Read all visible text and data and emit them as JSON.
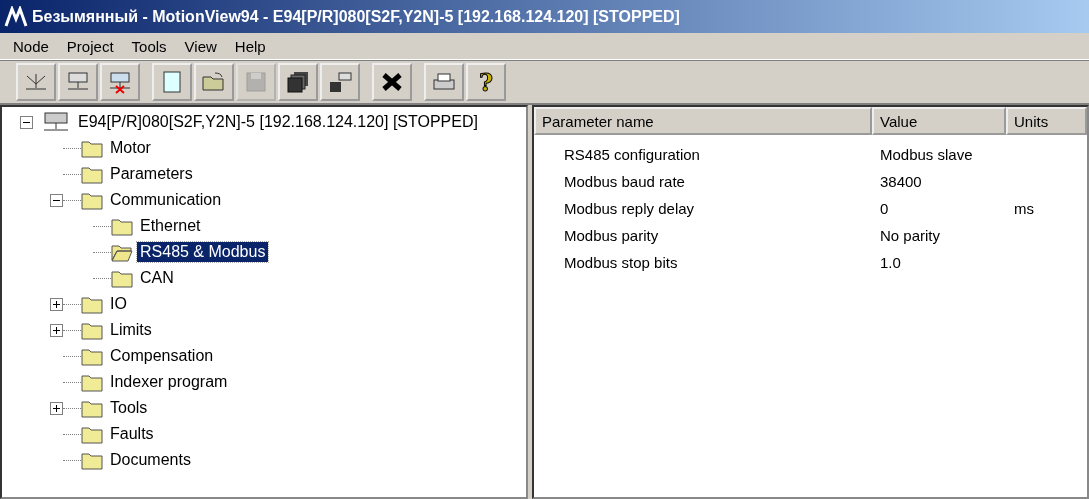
{
  "window": {
    "title": "Безымянный - MotionView94 - E94[P/R]080[S2F,Y2N]-5 [192.168.124.120] [STOPPED]"
  },
  "menu": [
    "Node",
    "Project",
    "Tools",
    "View",
    "Help"
  ],
  "toolbar": {
    "groups": [
      [
        {
          "disabled": false
        },
        {
          "disabled": false
        },
        {
          "disabled": false
        }
      ],
      [
        {
          "disabled": false
        },
        {
          "disabled": false
        },
        {
          "disabled": true
        },
        {
          "disabled": false
        },
        {
          "disabled": false
        }
      ],
      [
        {
          "disabled": false
        }
      ],
      [
        {
          "disabled": false
        },
        {
          "disabled": false,
          "label": "?"
        }
      ]
    ]
  },
  "tree": {
    "label": "E94[P/R]080[S2F,Y2N]-5 [192.168.124.120] [STOPPED]",
    "expanded": true,
    "children": [
      {
        "label": "Motor",
        "selected": false
      },
      {
        "label": "Parameters",
        "selected": false
      },
      {
        "label": "Communication",
        "expanded": true,
        "selected": false,
        "children": [
          {
            "label": "Ethernet",
            "selected": false
          },
          {
            "label": "RS485 & Modbus",
            "selected": true
          },
          {
            "label": "CAN",
            "selected": false
          }
        ]
      },
      {
        "label": "IO",
        "expanded": false,
        "selected": false
      },
      {
        "label": "Limits",
        "expanded": false,
        "selected": false
      },
      {
        "label": "Compensation",
        "selected": false
      },
      {
        "label": "Indexer program",
        "selected": false
      },
      {
        "label": "Tools",
        "expanded": false,
        "selected": false
      },
      {
        "label": "Faults",
        "selected": false
      },
      {
        "label": "Documents",
        "selected": false
      }
    ]
  },
  "table": {
    "columns": [
      "Parameter name",
      "Value",
      "Units"
    ],
    "rows": [
      [
        "RS485 configuration",
        "Modbus slave",
        ""
      ],
      [
        "Modbus baud rate",
        "38400",
        ""
      ],
      [
        "Modbus reply delay",
        "0",
        "ms"
      ],
      [
        "Modbus parity",
        "No parity",
        ""
      ],
      [
        "Modbus stop bits",
        "1.0",
        ""
      ]
    ]
  }
}
